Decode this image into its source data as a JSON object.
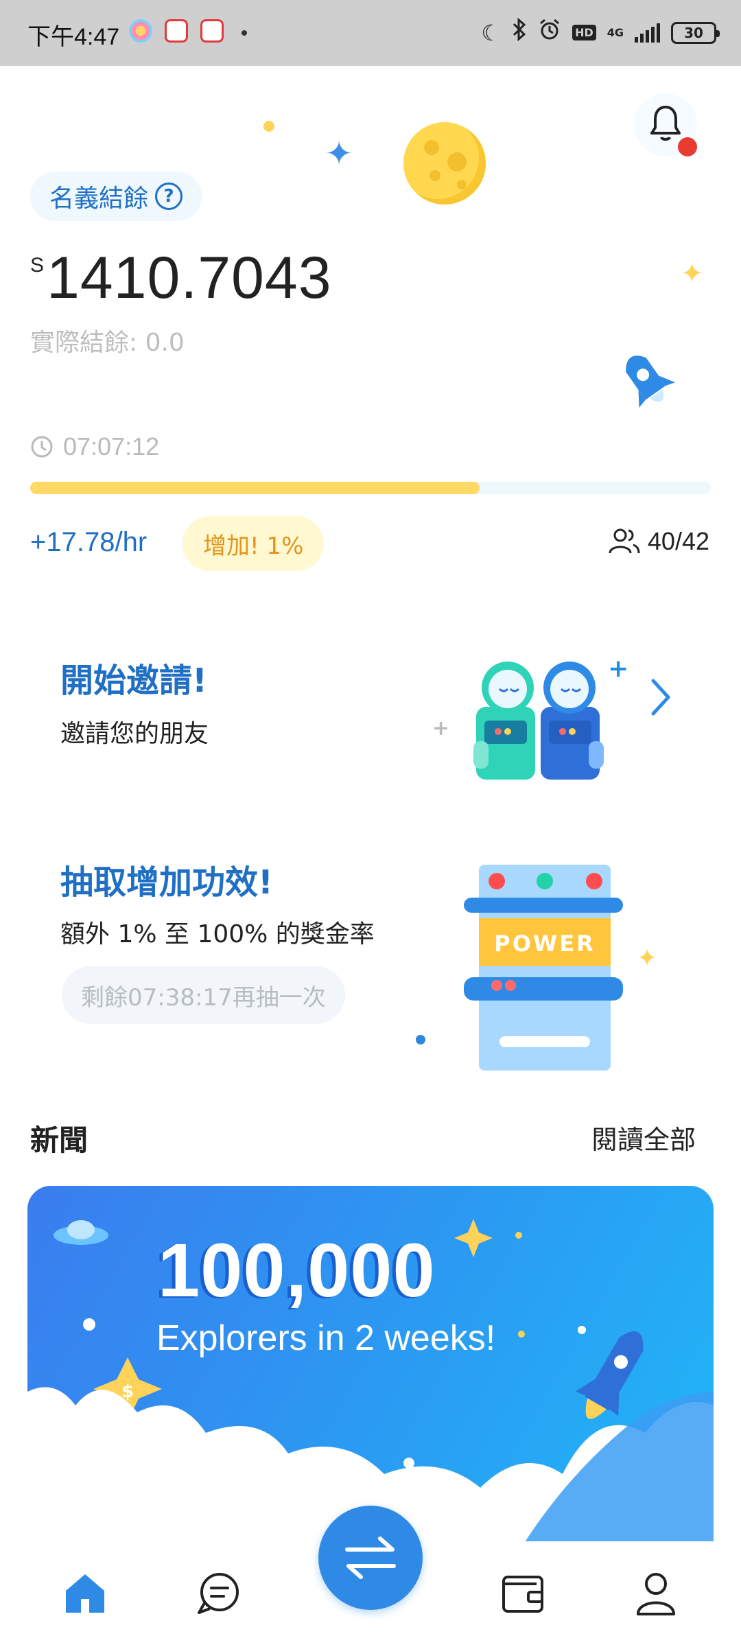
{
  "status_bar": {
    "time": "下午4:47",
    "network": "4G",
    "hd_label": "HD",
    "battery": "30",
    "icons": [
      "moon-icon",
      "bluetooth-icon",
      "alarm-icon",
      "hd-icon",
      "signal-icon",
      "battery-icon"
    ]
  },
  "header": {
    "nominal_label": "名義結餘",
    "help_icon": "?",
    "currency_symbol": "S",
    "balance": "1410.7043",
    "actual_balance": "實際結餘: 0.0",
    "notification_badge": true
  },
  "mining": {
    "timer": "07:07:12",
    "progress": 0.66,
    "rate": "+17.78/hr",
    "boost_label": "增加! 1%",
    "members": "40/42"
  },
  "invite_card": {
    "title": "開始邀請!",
    "subtitle": "邀請您的朋友"
  },
  "draw_card": {
    "title": "抽取增加功效!",
    "subtitle": "額外 1% 至 100% 的獎金率",
    "cooldown": "剩餘07:38:17再抽一次",
    "machine_label": "POWER"
  },
  "news": {
    "title": "新聞",
    "read_all": "閱讀全部",
    "banner_headline": "100,000",
    "banner_subline": "Explorers in 2 weeks!"
  },
  "bottom_nav": {
    "items": [
      "home-icon",
      "chat-icon",
      "swap-icon",
      "wallet-icon",
      "profile-icon"
    ],
    "active": "home-icon"
  },
  "colors": {
    "primary_blue": "#1f6fc5",
    "accent_yellow": "#ffd966",
    "boost_text": "#e3951b",
    "badge_red": "#ea3b32",
    "fab_blue": "#2f8ae6"
  }
}
